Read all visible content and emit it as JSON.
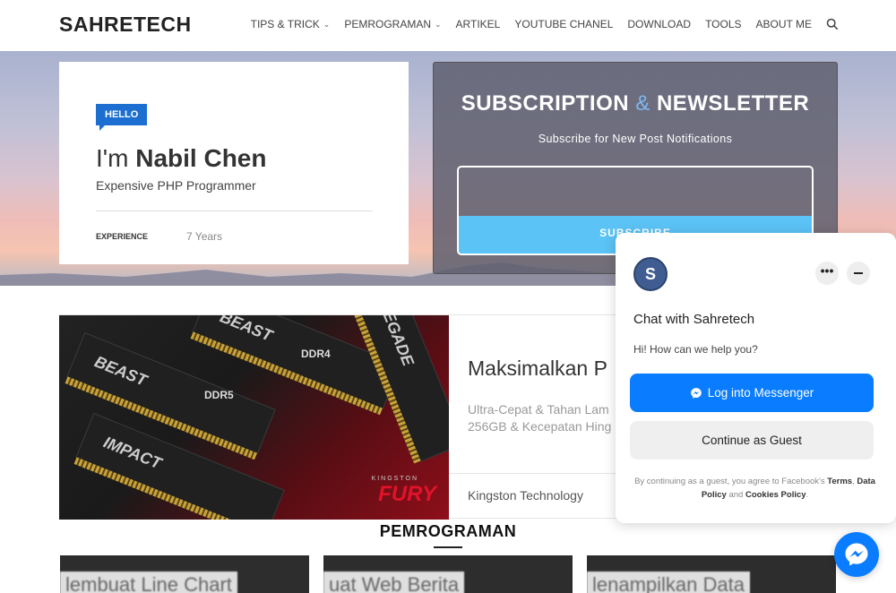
{
  "header": {
    "logo": "SAHRETECH",
    "nav": [
      {
        "label": "TIPS & TRICK",
        "dropdown": true
      },
      {
        "label": "PEMROGRAMAN",
        "dropdown": true
      },
      {
        "label": "ARTIKEL",
        "dropdown": false
      },
      {
        "label": "YOUTUBE CHANEL",
        "dropdown": false
      },
      {
        "label": "DOWNLOAD",
        "dropdown": false
      },
      {
        "label": "TOOLS",
        "dropdown": false
      },
      {
        "label": "ABOUT ME",
        "dropdown": false
      }
    ],
    "search_icon": "search-icon"
  },
  "profile": {
    "badge": "HELLO",
    "greeting": "I'm ",
    "name": "Nabil Chen",
    "role": "Expensive PHP Programmer",
    "experience_label": "EXPERIENCE",
    "experience_value": "7 Years"
  },
  "subscription": {
    "title_left": "SUBSCRIPTION",
    "title_amp": "&",
    "title_right": "NEWSLETTER",
    "subtitle": "Subscribe for New Post Notifications",
    "input_value": "",
    "button_label": "SUBSCRIBE"
  },
  "ad": {
    "title": "Maksimalkan P",
    "desc_line1": "Ultra-Cepat & Tahan Lam",
    "desc_line2": "256GB & Kecepatan Hing",
    "brand": "Kingston Technology",
    "image_labels": {
      "beast1": "BEAST",
      "beast2": "BEAST",
      "impact": "IMPACT",
      "renegade": "RENEGADE",
      "ddr4": "DDR4",
      "ddr5": "DDR5",
      "kingston": "KINGSTON",
      "fury": "FURY"
    }
  },
  "section": {
    "title": "PEMROGRAMAN"
  },
  "thumbnails": [
    {
      "text": "lembuat Line Chart"
    },
    {
      "text": "uat Web Berita"
    },
    {
      "text": "lenampilkan Data"
    }
  ],
  "chat": {
    "avatar_letter": "S",
    "more_label": "•••",
    "title": "Chat with Sahretech",
    "greeting": "Hi! How can we help you?",
    "messenger_button": "Log into Messenger",
    "guest_button": "Continue as Guest",
    "legal_prefix": "By continuing as a guest, you agree to Facebook's ",
    "legal_terms": "Terms",
    "legal_comma": ",",
    "legal_data": "Data Policy",
    "legal_and": " and ",
    "legal_cookies": "Cookies Policy",
    "legal_end": "."
  },
  "colors": {
    "accent": "#1c6fd1",
    "messenger": "#0a7cff",
    "subscribe": "#5bc3f5"
  }
}
